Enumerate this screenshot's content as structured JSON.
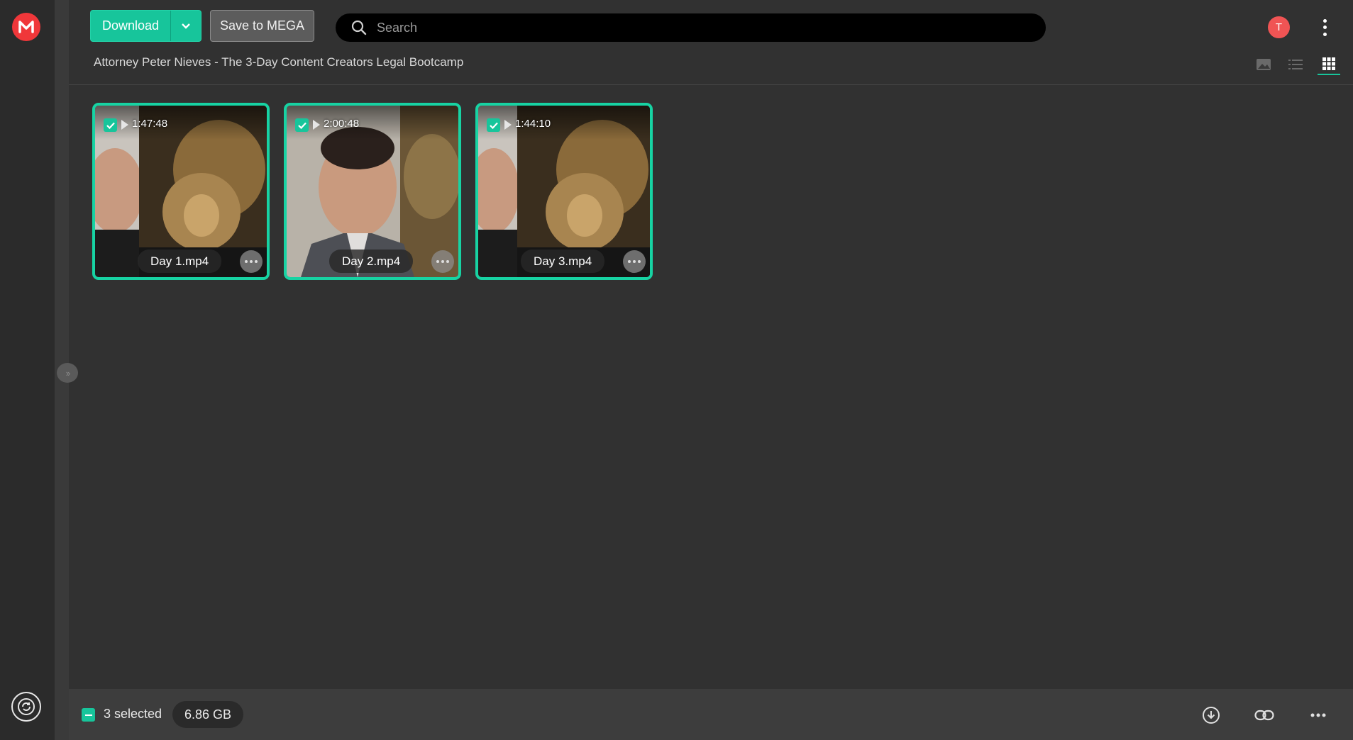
{
  "header": {
    "download_label": "Download",
    "save_label": "Save to MEGA",
    "search_placeholder": "Search",
    "avatar_initial": "T",
    "accent": "#17c59b"
  },
  "breadcrumb": "Attorney Peter Nieves - The 3-Day Content Creators Legal Bootcamp",
  "view_modes": [
    "thumbnail-icon",
    "list-view-icon",
    "grid-view-icon"
  ],
  "files": [
    {
      "name": "Day 1.mp4",
      "duration": "1:47:48",
      "selected": true
    },
    {
      "name": "Day 2.mp4",
      "duration": "2:00:48",
      "selected": true
    },
    {
      "name": "Day 3.mp4",
      "duration": "1:44:10",
      "selected": true
    }
  ],
  "footer": {
    "selected_text": "3 selected",
    "selected_size": "6.86 GB"
  }
}
